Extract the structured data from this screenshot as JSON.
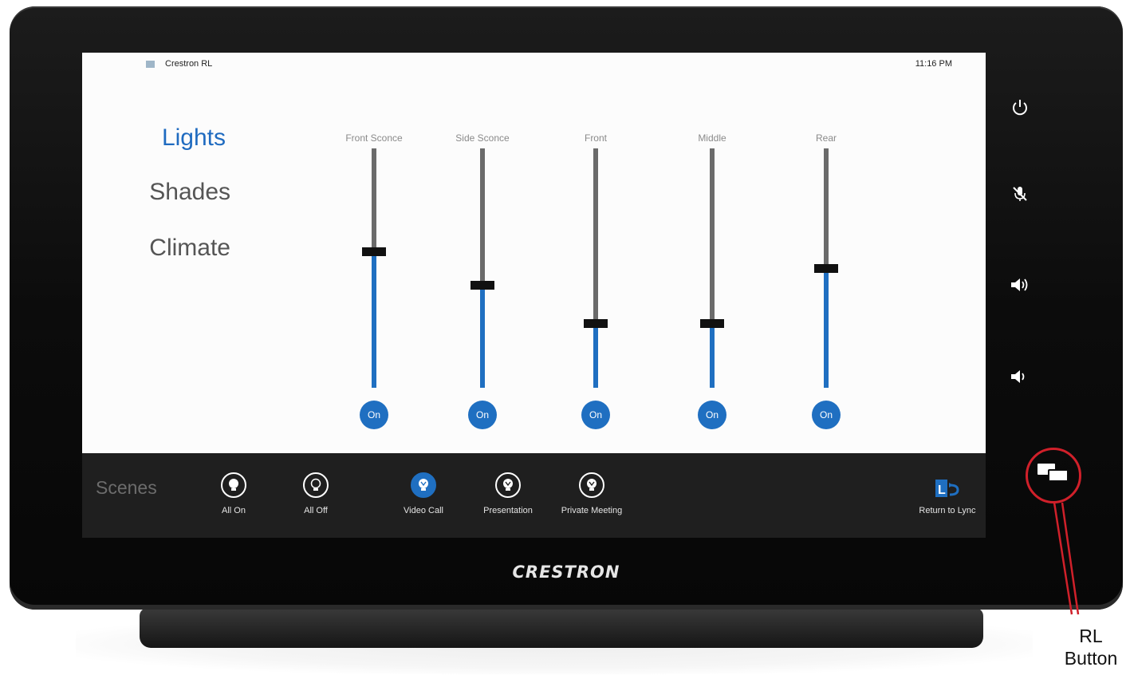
{
  "device": {
    "brand": "CRESTRON"
  },
  "screen": {
    "app_title": "Crestron RL",
    "clock": "11:16 PM"
  },
  "nav": [
    {
      "label": "Lights",
      "active": true
    },
    {
      "label": "Shades",
      "active": false
    },
    {
      "label": "Climate",
      "active": false
    }
  ],
  "channels": [
    {
      "label": "Front Sconce",
      "level": 0.57,
      "button": "On"
    },
    {
      "label": "Side Sconce",
      "level": 0.43,
      "button": "On"
    },
    {
      "label": "Front",
      "level": 0.27,
      "button": "On"
    },
    {
      "label": "Middle",
      "level": 0.27,
      "button": "On"
    },
    {
      "label": "Rear",
      "level": 0.5,
      "button": "On"
    }
  ],
  "scenes": {
    "title": "Scenes",
    "items": [
      {
        "label": "All On",
        "icon": "lightbulb-icon",
        "active": false
      },
      {
        "label": "All Off",
        "icon": "lightbulb-outline-icon",
        "active": false
      },
      {
        "label": "Video Call",
        "icon": "lightbulb-icon",
        "active": true
      },
      {
        "label": "Presentation",
        "icon": "lightbulb-icon",
        "active": false
      },
      {
        "label": "Private Meeting",
        "icon": "lightbulb-icon",
        "active": false
      }
    ],
    "return_label": "Return to Lync"
  },
  "hardware_buttons": [
    "power-icon",
    "mic-mute-icon",
    "volume-up-icon",
    "volume-down-icon",
    "rl-button-icon"
  ],
  "callout": {
    "label_line1": "RL",
    "label_line2": "Button"
  },
  "colors": {
    "accent": "#1f6fc1",
    "callout": "#d0202a",
    "bezel": "#0c0c0c"
  }
}
